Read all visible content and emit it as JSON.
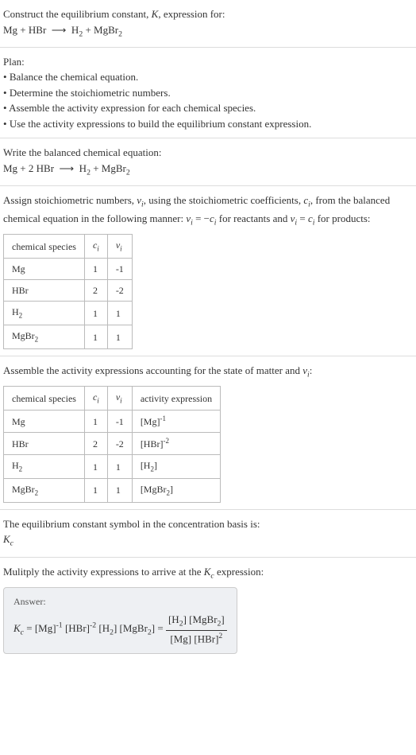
{
  "intro": {
    "line1": "Construct the equilibrium constant, K, expression for:",
    "equation_unbalanced": "Mg + HBr ⟶ H₂ + MgBr₂"
  },
  "plan": {
    "heading": "Plan:",
    "items": [
      "Balance the chemical equation.",
      "Determine the stoichiometric numbers.",
      "Assemble the activity expression for each chemical species.",
      "Use the activity expressions to build the equilibrium constant expression."
    ]
  },
  "balanced": {
    "heading": "Write the balanced chemical equation:",
    "equation": "Mg + 2 HBr ⟶ H₂ + MgBr₂"
  },
  "stoich": {
    "text_a": "Assign stoichiometric numbers, νᵢ, using the stoichiometric coefficients, cᵢ, from the balanced chemical equation in the following manner: νᵢ = −cᵢ for reactants and νᵢ = cᵢ for products:",
    "headers": [
      "chemical species",
      "cᵢ",
      "νᵢ"
    ],
    "rows": [
      {
        "sp": "Mg",
        "c": "1",
        "v": "-1"
      },
      {
        "sp": "HBr",
        "c": "2",
        "v": "-2"
      },
      {
        "sp": "H₂",
        "c": "1",
        "v": "1"
      },
      {
        "sp": "MgBr₂",
        "c": "1",
        "v": "1"
      }
    ]
  },
  "activity": {
    "text": "Assemble the activity expressions accounting for the state of matter and νᵢ:",
    "headers": [
      "chemical species",
      "cᵢ",
      "νᵢ",
      "activity expression"
    ],
    "rows": [
      {
        "sp": "Mg",
        "c": "1",
        "v": "-1",
        "a": "[Mg]⁻¹"
      },
      {
        "sp": "HBr",
        "c": "2",
        "v": "-2",
        "a": "[HBr]⁻²"
      },
      {
        "sp": "H₂",
        "c": "1",
        "v": "1",
        "a": "[H₂]"
      },
      {
        "sp": "MgBr₂",
        "c": "1",
        "v": "1",
        "a": "[MgBr₂]"
      }
    ]
  },
  "symbol": {
    "text": "The equilibrium constant symbol in the concentration basis is:",
    "sym": "K꜀"
  },
  "final": {
    "text": "Mulitply the activity expressions to arrive at the K꜀ expression:",
    "answer_label": "Answer:",
    "lhs": "K꜀ = [Mg]⁻¹ [HBr]⁻² [H₂] [MgBr₂] = ",
    "num": "[H₂] [MgBr₂]",
    "den": "[Mg] [HBr]²"
  }
}
